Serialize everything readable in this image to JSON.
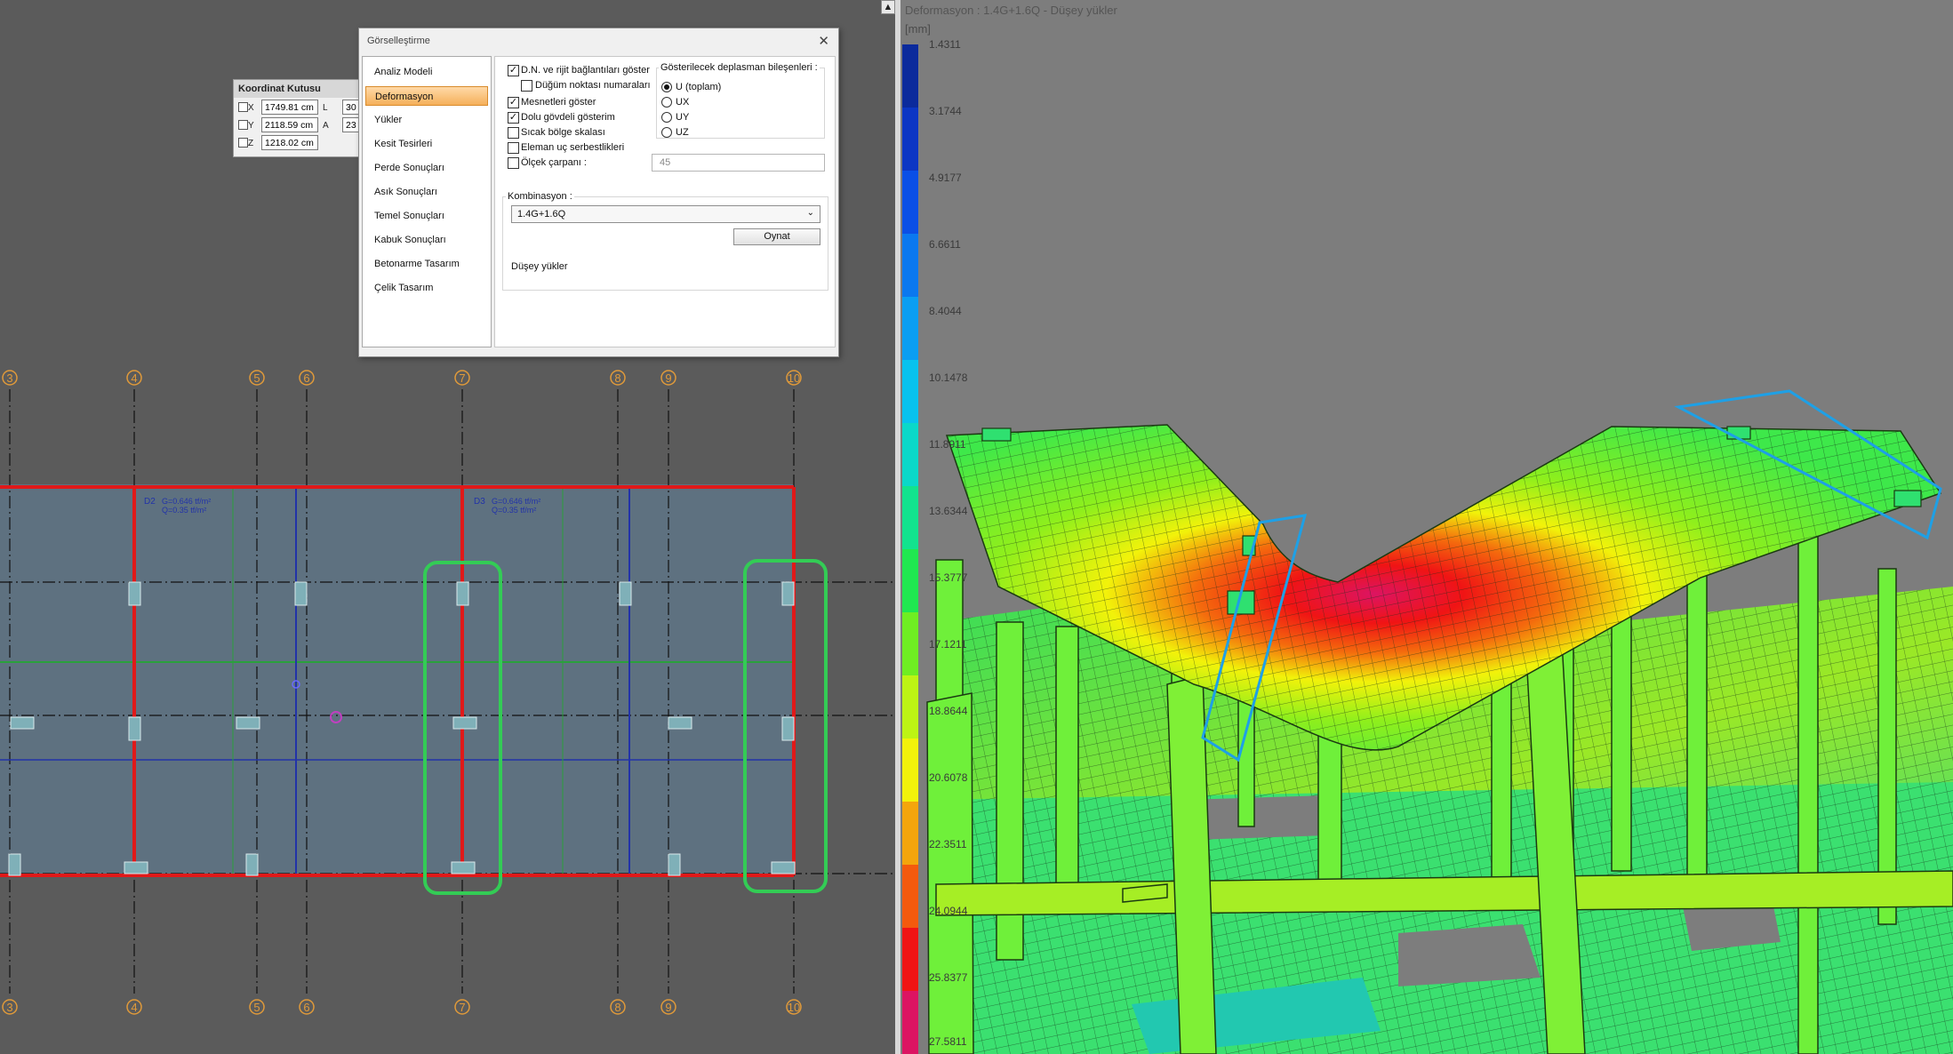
{
  "colors": {
    "plan_bg": "#5b5b5b",
    "slab_fill": "#5e7180",
    "beam_red": "#e01919",
    "highlight_green": "#33cc55",
    "axis_orange": "#e09a3a",
    "v3d_bg": "#7d7d7d",
    "selection_blue": "#1ea0e6"
  },
  "plan": {
    "axes": [
      "3",
      "4",
      "5",
      "6",
      "7",
      "8",
      "9",
      "10"
    ],
    "slab_labels": [
      {
        "name": "D2",
        "g": "G=0.646 tf/m²",
        "q": "Q=0.35 tf/m²"
      },
      {
        "name": "D3",
        "g": "G=0.646 tf/m²",
        "q": "Q=0.35 tf/m²"
      }
    ]
  },
  "splitter": {
    "arrow_icon": "arrow-up-icon",
    "arrow_glyph": "▲"
  },
  "coord_box": {
    "title": "Koordinat Kutusu",
    "rows": [
      {
        "axis": "X",
        "value": "1749.81 cm",
        "param": "L",
        "param_value": "30"
      },
      {
        "axis": "Y",
        "value": "2118.59 cm",
        "param": "A",
        "param_value": "23"
      },
      {
        "axis": "Z",
        "value": "1218.02 cm",
        "param": "",
        "param_value": ""
      }
    ]
  },
  "dialog": {
    "title": "Görselleştirme",
    "close_glyph": "✕",
    "nav": [
      "Analiz Modeli",
      "Deformasyon",
      "Yükler",
      "Kesit Tesirleri",
      "Perde Sonuçları",
      "Asık Sonuçları",
      "Temel Sonuçları",
      "Kabuk Sonuçları",
      "Betonarme Tasarım",
      "Çelik Tasarım"
    ],
    "selected_nav": "Deformasyon",
    "options": [
      {
        "label": "D.N. ve rijit bağlantıları göster",
        "checked": true
      },
      {
        "label": "Düğüm noktası numaraları",
        "checked": false
      },
      {
        "label": "Mesnetleri göster",
        "checked": true
      },
      {
        "label": "Dolu gövdeli gösterim",
        "checked": true
      },
      {
        "label": "Sıcak bölge skalası",
        "checked": false
      },
      {
        "label": "Eleman uç serbestlikleri",
        "checked": false
      },
      {
        "label": "Ölçek çarpanı :",
        "checked": false
      }
    ],
    "scale_value": "45",
    "components_title": "Gösterilecek deplasman bileşenleri :",
    "components": [
      {
        "label": "U (toplam)",
        "selected": true
      },
      {
        "label": "UX",
        "selected": false
      },
      {
        "label": "UY",
        "selected": false
      },
      {
        "label": "UZ",
        "selected": false
      }
    ],
    "combination_label": "Kombinasyon :",
    "combination_value": "1.4G+1.6Q",
    "play_button": "Oynat",
    "description": "Düşey yükler"
  },
  "view3d": {
    "title": "Deformasyon : 1.4G+1.6Q  -  Düşey yükler",
    "unit": "[mm]",
    "legend_values": [
      "1.4311",
      "3.1744",
      "4.9177",
      "6.6611",
      "8.4044",
      "10.1478",
      "11.8911",
      "13.6344",
      "15.3777",
      "17.1211",
      "18.8644",
      "20.6078",
      "22.3511",
      "24.0944",
      "25.8377",
      "27.5811"
    ],
    "legend_colors": [
      "#0b2a9c",
      "#0c36c4",
      "#0a4fe6",
      "#0a78ef",
      "#0a9ef2",
      "#08c2ee",
      "#0ad8c9",
      "#12e38e",
      "#20e850",
      "#6fee22",
      "#bdf414",
      "#f2f20a",
      "#f4a50c",
      "#f45a0d",
      "#f01414",
      "#dc1462"
    ]
  }
}
